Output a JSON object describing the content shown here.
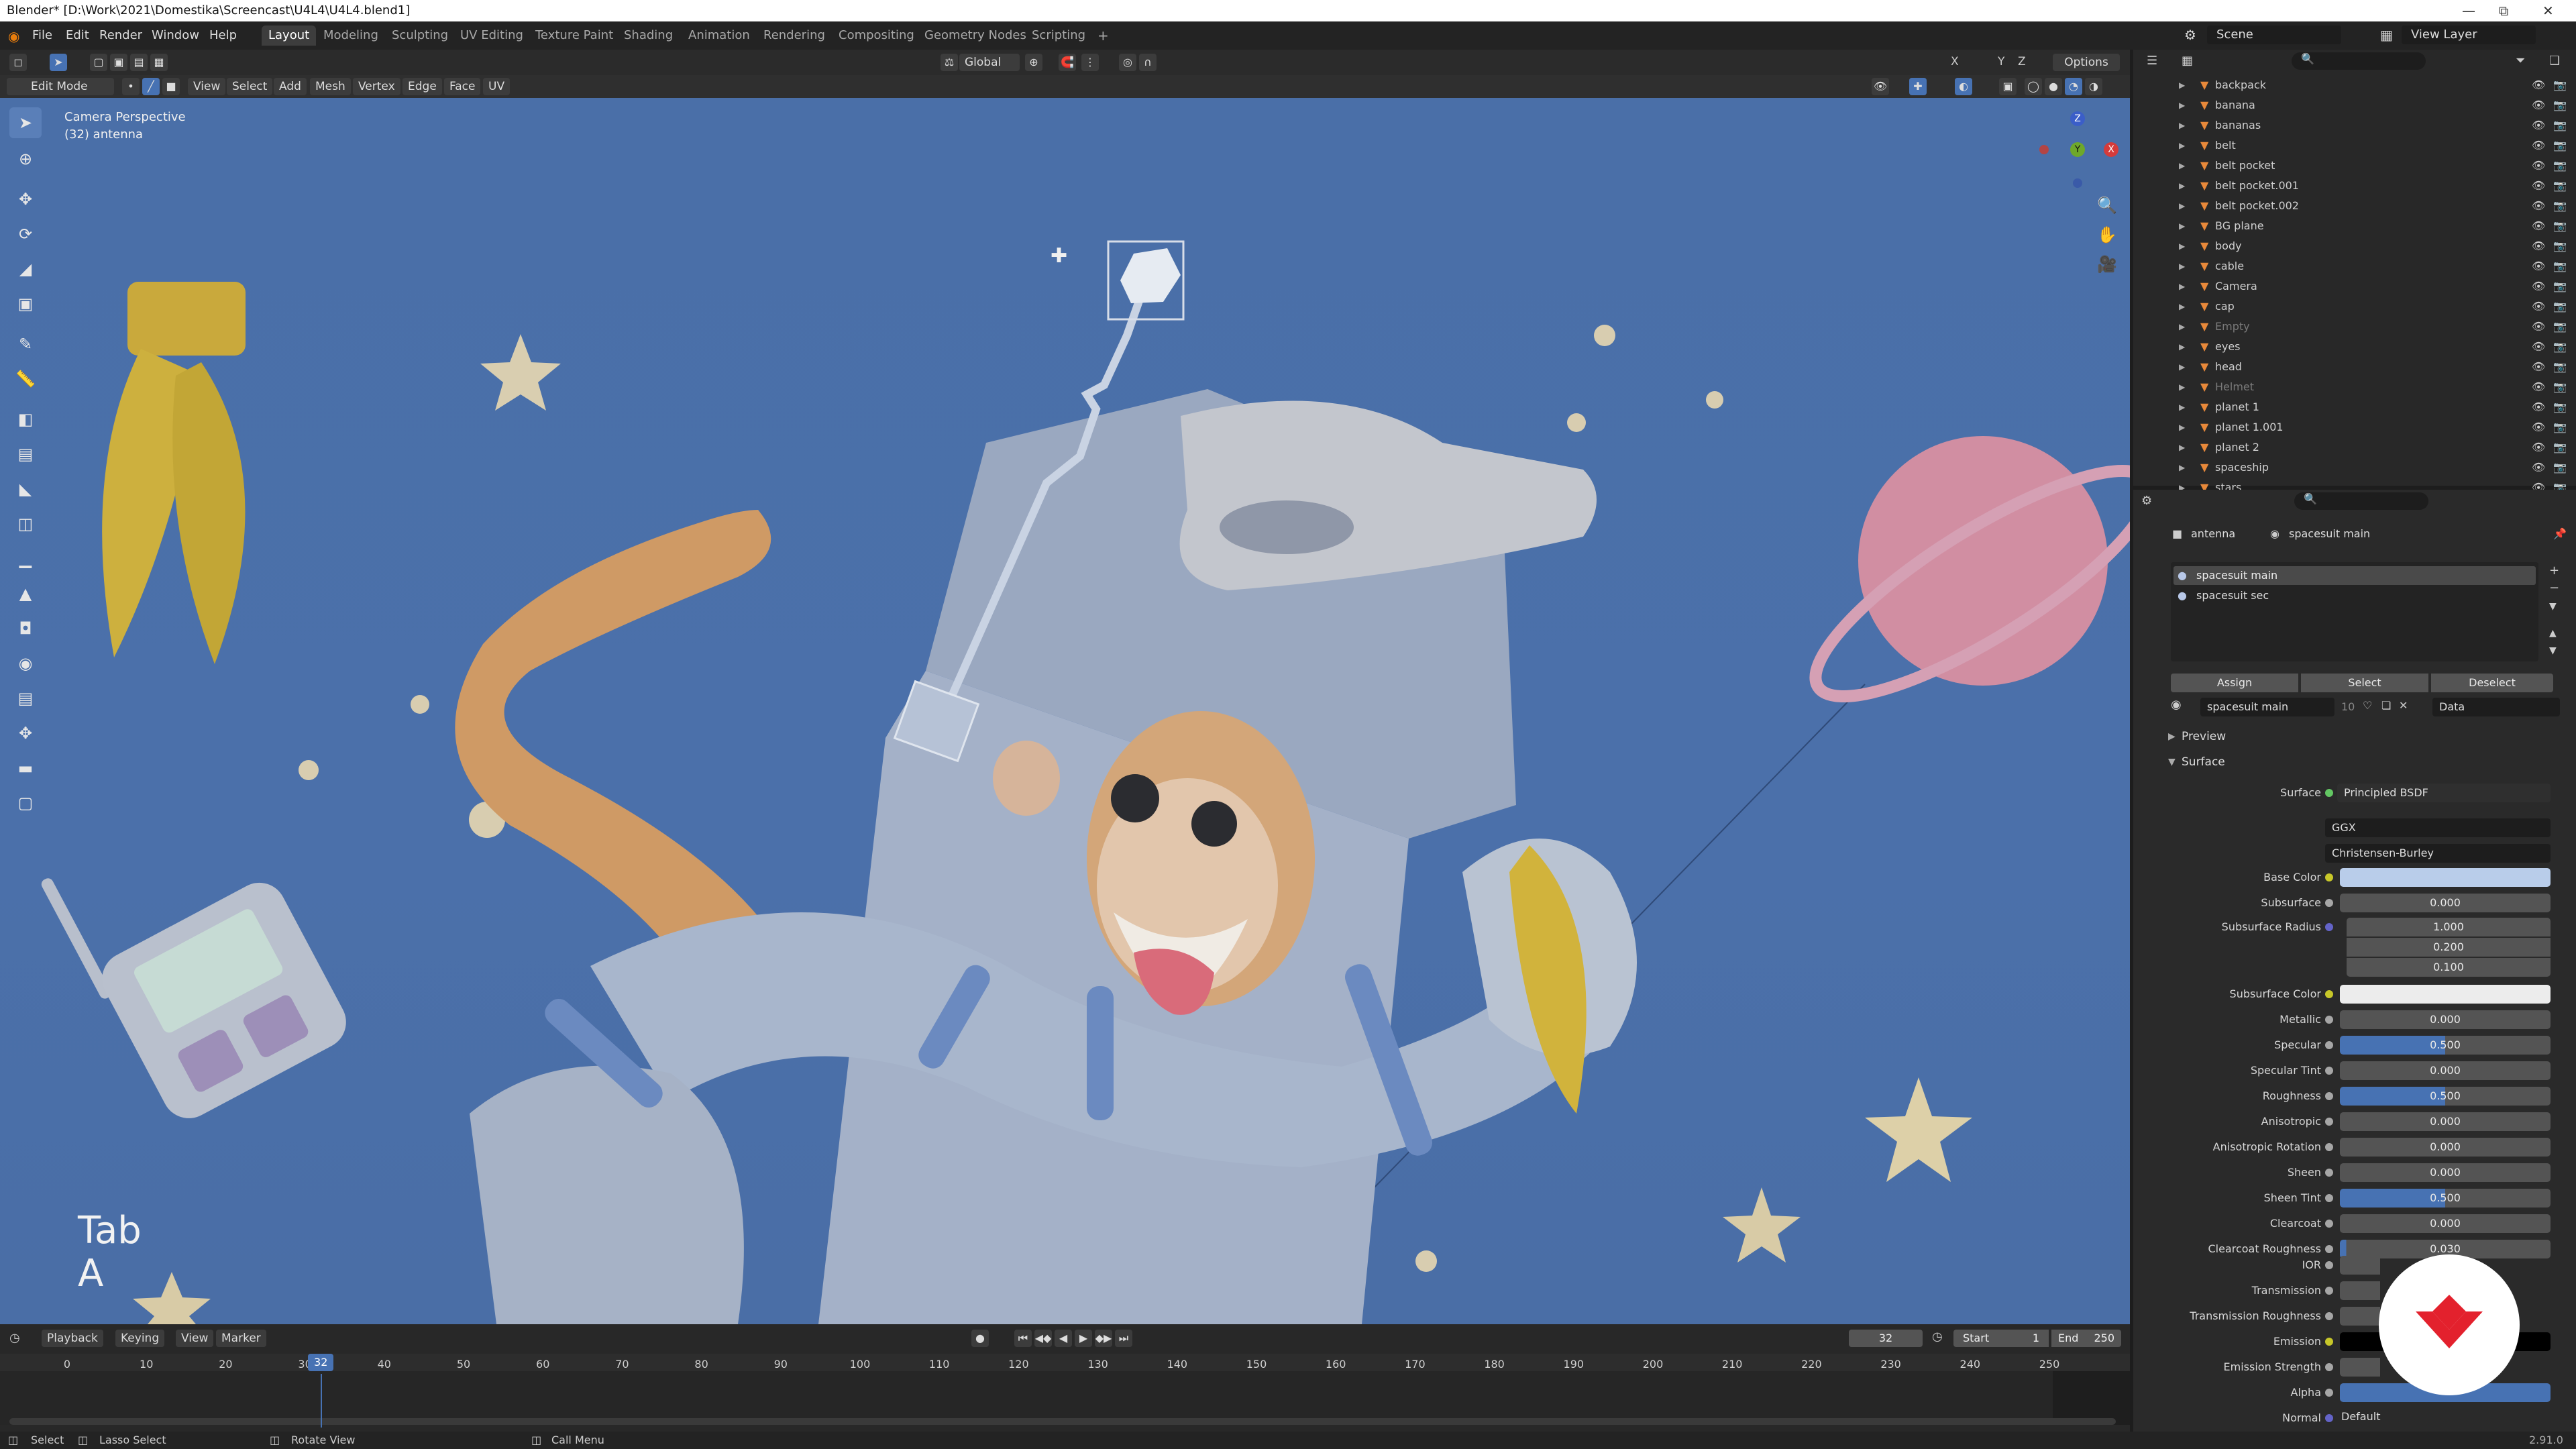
{
  "window": {
    "title": "Blender* [D:\\Work\\2021\\Domestika\\Screencast\\U4L4\\U4L4.blend1]"
  },
  "menu": [
    "File",
    "Edit",
    "Render",
    "Window",
    "Help"
  ],
  "workspaces": [
    "Layout",
    "Modeling",
    "Sculpting",
    "UV Editing",
    "Texture Paint",
    "Shading",
    "Animation",
    "Rendering",
    "Compositing",
    "Geometry Nodes",
    "Scripting"
  ],
  "active_workspace": "Layout",
  "scene": {
    "name": "Scene",
    "view_layer": "View Layer"
  },
  "header": {
    "transform_orientation": "Global",
    "options": "Options",
    "mode": "Edit Mode",
    "menus": [
      "View",
      "Select",
      "Add",
      "Mesh",
      "Vertex",
      "Edge",
      "Face",
      "UV"
    ],
    "axes": [
      "X",
      "Y",
      "Z"
    ]
  },
  "viewport": {
    "perspective": "Camera Perspective",
    "object_info": "(32) antenna",
    "keys_overlay_1": "Tab",
    "keys_overlay_2": "A",
    "nav_axes": [
      "Z",
      "Y",
      "X"
    ]
  },
  "outliner": {
    "items": [
      {
        "name": "backpack",
        "dim": false
      },
      {
        "name": "banana",
        "dim": false
      },
      {
        "name": "bananas",
        "dim": false
      },
      {
        "name": "belt",
        "dim": false
      },
      {
        "name": "belt pocket",
        "dim": false
      },
      {
        "name": "belt pocket.001",
        "dim": false
      },
      {
        "name": "belt pocket.002",
        "dim": false
      },
      {
        "name": "BG plane",
        "dim": false
      },
      {
        "name": "body",
        "dim": false
      },
      {
        "name": "cable",
        "dim": false
      },
      {
        "name": "Camera",
        "dim": false
      },
      {
        "name": "cap",
        "dim": false
      },
      {
        "name": "Empty",
        "dim": true
      },
      {
        "name": "eyes",
        "dim": false
      },
      {
        "name": "head",
        "dim": false
      },
      {
        "name": "Helmet",
        "dim": true
      },
      {
        "name": "planet 1",
        "dim": false
      },
      {
        "name": "planet 1.001",
        "dim": false
      },
      {
        "name": "planet 2",
        "dim": false
      },
      {
        "name": "spaceship",
        "dim": false
      },
      {
        "name": "stars",
        "dim": false
      }
    ]
  },
  "properties": {
    "object": "antenna",
    "material": "spacesuit main",
    "slots": [
      "spacesuit main",
      "spacesuit sec"
    ],
    "assign": "Assign",
    "select": "Select",
    "deselect": "Deselect",
    "material_users": "10",
    "link": "Data",
    "preview": "Preview",
    "surface_panel": "Surface",
    "surface_label": "Surface",
    "surface_shader": "Principled BSDF",
    "distribution": "GGX",
    "subsurface_method": "Christensen-Burley",
    "base_color": "#b9cdea",
    "subsurface_color": "#ececec",
    "fields": [
      {
        "label": "Subsurface",
        "value": "0.000",
        "fill": 0
      },
      {
        "label": "Metallic",
        "value": "0.000",
        "fill": 0
      },
      {
        "label": "Specular",
        "value": "0.500",
        "fill": 0.5
      },
      {
        "label": "Specular Tint",
        "value": "0.000",
        "fill": 0
      },
      {
        "label": "Roughness",
        "value": "0.500",
        "fill": 0.5
      },
      {
        "label": "Anisotropic",
        "value": "0.000",
        "fill": 0
      },
      {
        "label": "Anisotropic Rotation",
        "value": "0.000",
        "fill": 0
      },
      {
        "label": "Sheen",
        "value": "0.000",
        "fill": 0
      },
      {
        "label": "Sheen Tint",
        "value": "0.500",
        "fill": 0.5
      },
      {
        "label": "Clearcoat",
        "value": "0.000",
        "fill": 0
      },
      {
        "label": "Clearcoat Roughness",
        "value": "0.030",
        "fill": 0.03
      }
    ],
    "labels": {
      "base_color": "Base Color",
      "subsurface_radius": "Subsurface Radius",
      "subsurface_color": "Subsurface Color",
      "ior": "IOR",
      "transmission": "Transmission",
      "transmission_roughness": "Transmission Roughness",
      "emission": "Emission",
      "emission_strength": "Emission Strength",
      "alpha": "Alpha",
      "normal": "Normal"
    },
    "subsurface_radius": [
      "1.000",
      "0.200",
      "0.100"
    ],
    "normal_value": "Default"
  },
  "timeline": {
    "menus": [
      "Playback",
      "Keying",
      "View",
      "Marker"
    ],
    "current_frame": "32",
    "start_label": "Start",
    "start": "1",
    "end_label": "End",
    "end": "250",
    "ticks": [
      "0",
      "10",
      "20",
      "30",
      "40",
      "50",
      "60",
      "70",
      "80",
      "90",
      "100",
      "110",
      "120",
      "130",
      "140",
      "150",
      "160",
      "170",
      "180",
      "190",
      "200",
      "210",
      "220",
      "230",
      "240",
      "250"
    ]
  },
  "statusbar": {
    "select": "Select",
    "lasso": "Lasso Select",
    "rotate": "Rotate View",
    "call_menu": "Call Menu",
    "version": "2.91.0"
  }
}
